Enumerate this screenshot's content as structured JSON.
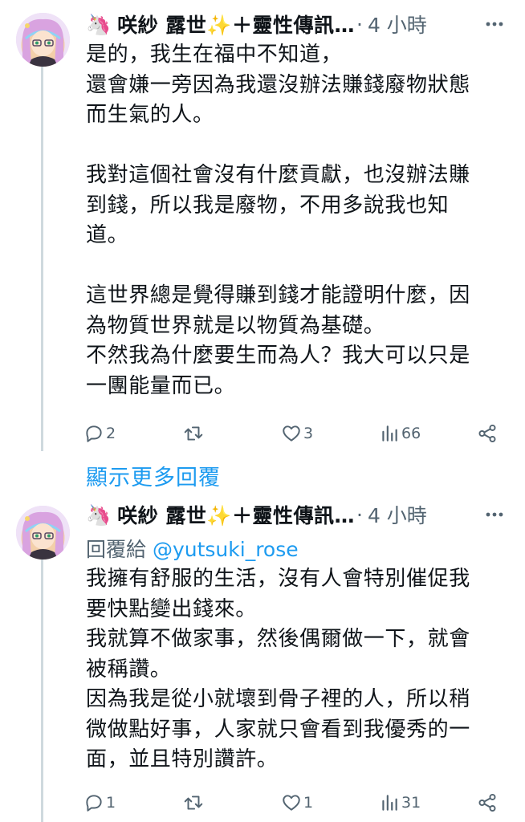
{
  "tweets": [
    {
      "author": {
        "emoji": "🦄",
        "display_name": "咲紗 露世✨＋靈性傳訊…"
      },
      "separator": "·",
      "time": "4 小時",
      "reply_prefix": "",
      "reply_handle": "",
      "body": "是的，我生在福中不知道，\n還會嫌一旁因為我還沒辦法賺錢廢物狀態\n而生氣的人。\n\n我對這個社會沒有什麼貢獻，也沒辦法賺\n到錢，所以我是廢物，不用多說我也知\n道。\n\n這世界總是覺得賺到錢才能證明什麼，因\n為物質世界就是以物質為基礎。\n不然我為什麼要生而為人？我大可以只是\n一團能量而已。",
      "replies": "2",
      "retweets": "",
      "likes": "3",
      "views": "66"
    },
    {
      "author": {
        "emoji": "🦄",
        "display_name": "咲紗 露世✨＋靈性傳訊…"
      },
      "separator": "·",
      "time": "4 小時",
      "reply_prefix": "回覆給 ",
      "reply_handle": "@yutsuki_rose",
      "body": "我擁有舒服的生活，沒有人會特別催促我\n要快點變出錢來。\n我就算不做家事，然後偶爾做一下，就會\n被稱讚。\n因為我是從小就壞到骨子裡的人，所以稍\n微做點好事，人家就只會看到我優秀的一\n面，並且特別讚許。",
      "replies": "1",
      "retweets": "",
      "likes": "1",
      "views": "31"
    }
  ],
  "show_more_replies": "顯示更多回覆",
  "colors": {
    "text": "#0f1419",
    "secondary": "#536471",
    "link": "#1d9bf0",
    "thread_line": "#cfd9de"
  },
  "icons": [
    "more-icon",
    "reply-icon",
    "retweet-icon",
    "like-icon",
    "views-icon",
    "share-icon"
  ]
}
